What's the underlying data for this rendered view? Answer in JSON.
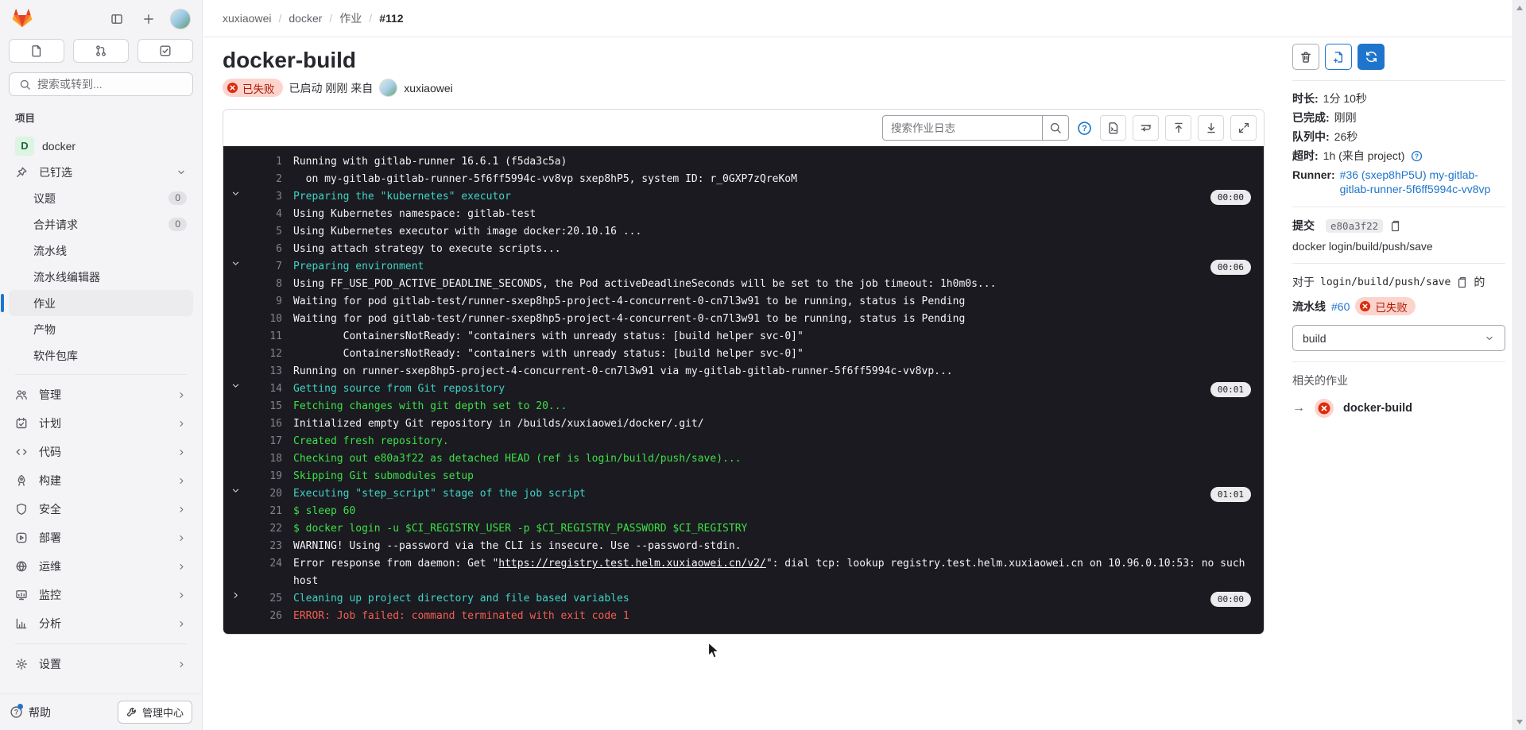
{
  "colors": {
    "accent_blue": "#1f75cb",
    "failed_red": "#dd2b0e",
    "failed_badge_bg": "#fdd4cd",
    "failed_badge_text": "#ae1800",
    "log_background": "#1b1a20",
    "log_section_teal": "#3fd3c6",
    "log_green": "#3ce048",
    "log_error_red": "#f65e4f"
  },
  "sidebar": {
    "search_placeholder": "搜索或转到...",
    "projects_heading": "项目",
    "project": {
      "initial": "D",
      "name": "docker"
    },
    "pinned_label": "已钉选",
    "pinned_items": [
      {
        "label": "议题",
        "count": "0"
      },
      {
        "label": "合并请求",
        "count": "0"
      },
      {
        "label": "流水线"
      },
      {
        "label": "流水线编辑器"
      },
      {
        "label": "作业",
        "active": true
      },
      {
        "label": "产物"
      },
      {
        "label": "软件包库"
      }
    ],
    "sections": [
      {
        "label": "管理",
        "icon": "users-icon"
      },
      {
        "label": "计划",
        "icon": "calendar-icon"
      },
      {
        "label": "代码",
        "icon": "code-icon"
      },
      {
        "label": "构建",
        "icon": "rocket-icon"
      },
      {
        "label": "安全",
        "icon": "shield-icon"
      },
      {
        "label": "部署",
        "icon": "deploy-icon"
      },
      {
        "label": "运维",
        "icon": "operations-icon"
      },
      {
        "label": "监控",
        "icon": "monitor-icon"
      },
      {
        "label": "分析",
        "icon": "chart-icon"
      },
      {
        "label": "设置",
        "icon": "gear-icon",
        "divider_before": true
      }
    ],
    "footer": {
      "help": "帮助",
      "admin": "管理中心"
    }
  },
  "header": {
    "breadcrumb": [
      "xuxiaowei",
      "docker",
      "作业",
      "#112"
    ],
    "title": "docker-build",
    "status_badge": "已失败",
    "started_text": "已启动 刚刚 来自",
    "user": "xuxiaowei"
  },
  "log_toolbar": {
    "search_placeholder": "搜索作业日志"
  },
  "log": {
    "lines": [
      {
        "num": 1,
        "type": "normal",
        "text": "Running with gitlab-runner 16.6.1 (f5da3c5a)"
      },
      {
        "num": 2,
        "type": "normal",
        "text": "  on my-gitlab-gitlab-runner-5f6ff5994c-vv8vp sxep8hP5, system ID: r_0GXP7zQreKoM"
      },
      {
        "num": 3,
        "type": "section",
        "text": "Preparing the \"kubernetes\" executor",
        "duration": "00:00",
        "collapsed": false
      },
      {
        "num": 4,
        "type": "normal",
        "text": "Using Kubernetes namespace: gitlab-test"
      },
      {
        "num": 5,
        "type": "normal",
        "text": "Using Kubernetes executor with image docker:20.10.16 ..."
      },
      {
        "num": 6,
        "type": "normal",
        "text": "Using attach strategy to execute scripts..."
      },
      {
        "num": 7,
        "type": "section",
        "text": "Preparing environment",
        "duration": "00:06",
        "collapsed": false
      },
      {
        "num": 8,
        "type": "normal",
        "text": "Using FF_USE_POD_ACTIVE_DEADLINE_SECONDS, the Pod activeDeadlineSeconds will be set to the job timeout: 1h0m0s..."
      },
      {
        "num": 9,
        "type": "normal",
        "text": "Waiting for pod gitlab-test/runner-sxep8hp5-project-4-concurrent-0-cn7l3w91 to be running, status is Pending"
      },
      {
        "num": 10,
        "type": "normal",
        "text": "Waiting for pod gitlab-test/runner-sxep8hp5-project-4-concurrent-0-cn7l3w91 to be running, status is Pending"
      },
      {
        "num": 11,
        "type": "normal",
        "text": "        ContainersNotReady: \"containers with unready status: [build helper svc-0]\""
      },
      {
        "num": 12,
        "type": "normal",
        "text": "        ContainersNotReady: \"containers with unready status: [build helper svc-0]\""
      },
      {
        "num": 13,
        "type": "normal",
        "text": "Running on runner-sxep8hp5-project-4-concurrent-0-cn7l3w91 via my-gitlab-gitlab-runner-5f6ff5994c-vv8vp..."
      },
      {
        "num": 14,
        "type": "section",
        "text": "Getting source from Git repository",
        "duration": "00:01",
        "collapsed": false
      },
      {
        "num": 15,
        "type": "green",
        "text": "Fetching changes with git depth set to 20..."
      },
      {
        "num": 16,
        "type": "normal",
        "text": "Initialized empty Git repository in /builds/xuxiaowei/docker/.git/"
      },
      {
        "num": 17,
        "type": "green",
        "text": "Created fresh repository."
      },
      {
        "num": 18,
        "type": "green",
        "text": "Checking out e80a3f22 as detached HEAD (ref is login/build/push/save)..."
      },
      {
        "num": 19,
        "type": "green",
        "text": "Skipping Git submodules setup"
      },
      {
        "num": 20,
        "type": "section",
        "text": "Executing \"step_script\" stage of the job script",
        "duration": "01:01",
        "collapsed": false
      },
      {
        "num": 21,
        "type": "green",
        "text": "$ sleep 60"
      },
      {
        "num": 22,
        "type": "green",
        "text": "$ docker login -u $CI_REGISTRY_USER -p $CI_REGISTRY_PASSWORD $CI_REGISTRY"
      },
      {
        "num": 23,
        "type": "normal",
        "text": "WARNING! Using --password via the CLI is insecure. Use --password-stdin."
      },
      {
        "num": 24,
        "type": "normal",
        "segments": [
          {
            "kind": "text",
            "text": "Error response from daemon: Get \""
          },
          {
            "kind": "link",
            "text": "https://registry.test.helm.xuxiaowei.cn/v2/"
          },
          {
            "kind": "text",
            "text": "\": dial tcp: lookup registry.test.helm.xuxiaowei.cn on 10.96.0.10:53: no such host"
          }
        ]
      },
      {
        "num": 25,
        "type": "section",
        "text": "Cleaning up project directory and file based variables",
        "duration": "00:00",
        "collapsed": true
      },
      {
        "num": 26,
        "type": "red",
        "text": "ERROR: Job failed: command terminated with exit code 1"
      }
    ]
  },
  "details": {
    "rows": [
      {
        "label": "时长:",
        "value": "1分 10秒"
      },
      {
        "label": "已完成:",
        "value": "刚刚"
      },
      {
        "label": "队列中:",
        "value": "26秒"
      },
      {
        "label": "超时:",
        "value": "1h (来自 project)",
        "help": true
      },
      {
        "label": "Runner:",
        "value": "#36 (sxep8hP5U) my-gitlab-gitlab-runner-5f6ff5994c-vv8vp",
        "link": true
      }
    ],
    "commit_label": "提交",
    "commit_sha": "e80a3f22",
    "commit_message": "docker login/build/push/save",
    "pipeline_prefix": "对于",
    "pipeline_ref": "login/build/push/save",
    "pipeline_suffix": "的",
    "pipeline_label": "流水线",
    "pipeline_number": "#60",
    "pipeline_status": "已失败",
    "stage_value": "build",
    "related_label": "相关的作业",
    "related_job": "docker-build"
  }
}
